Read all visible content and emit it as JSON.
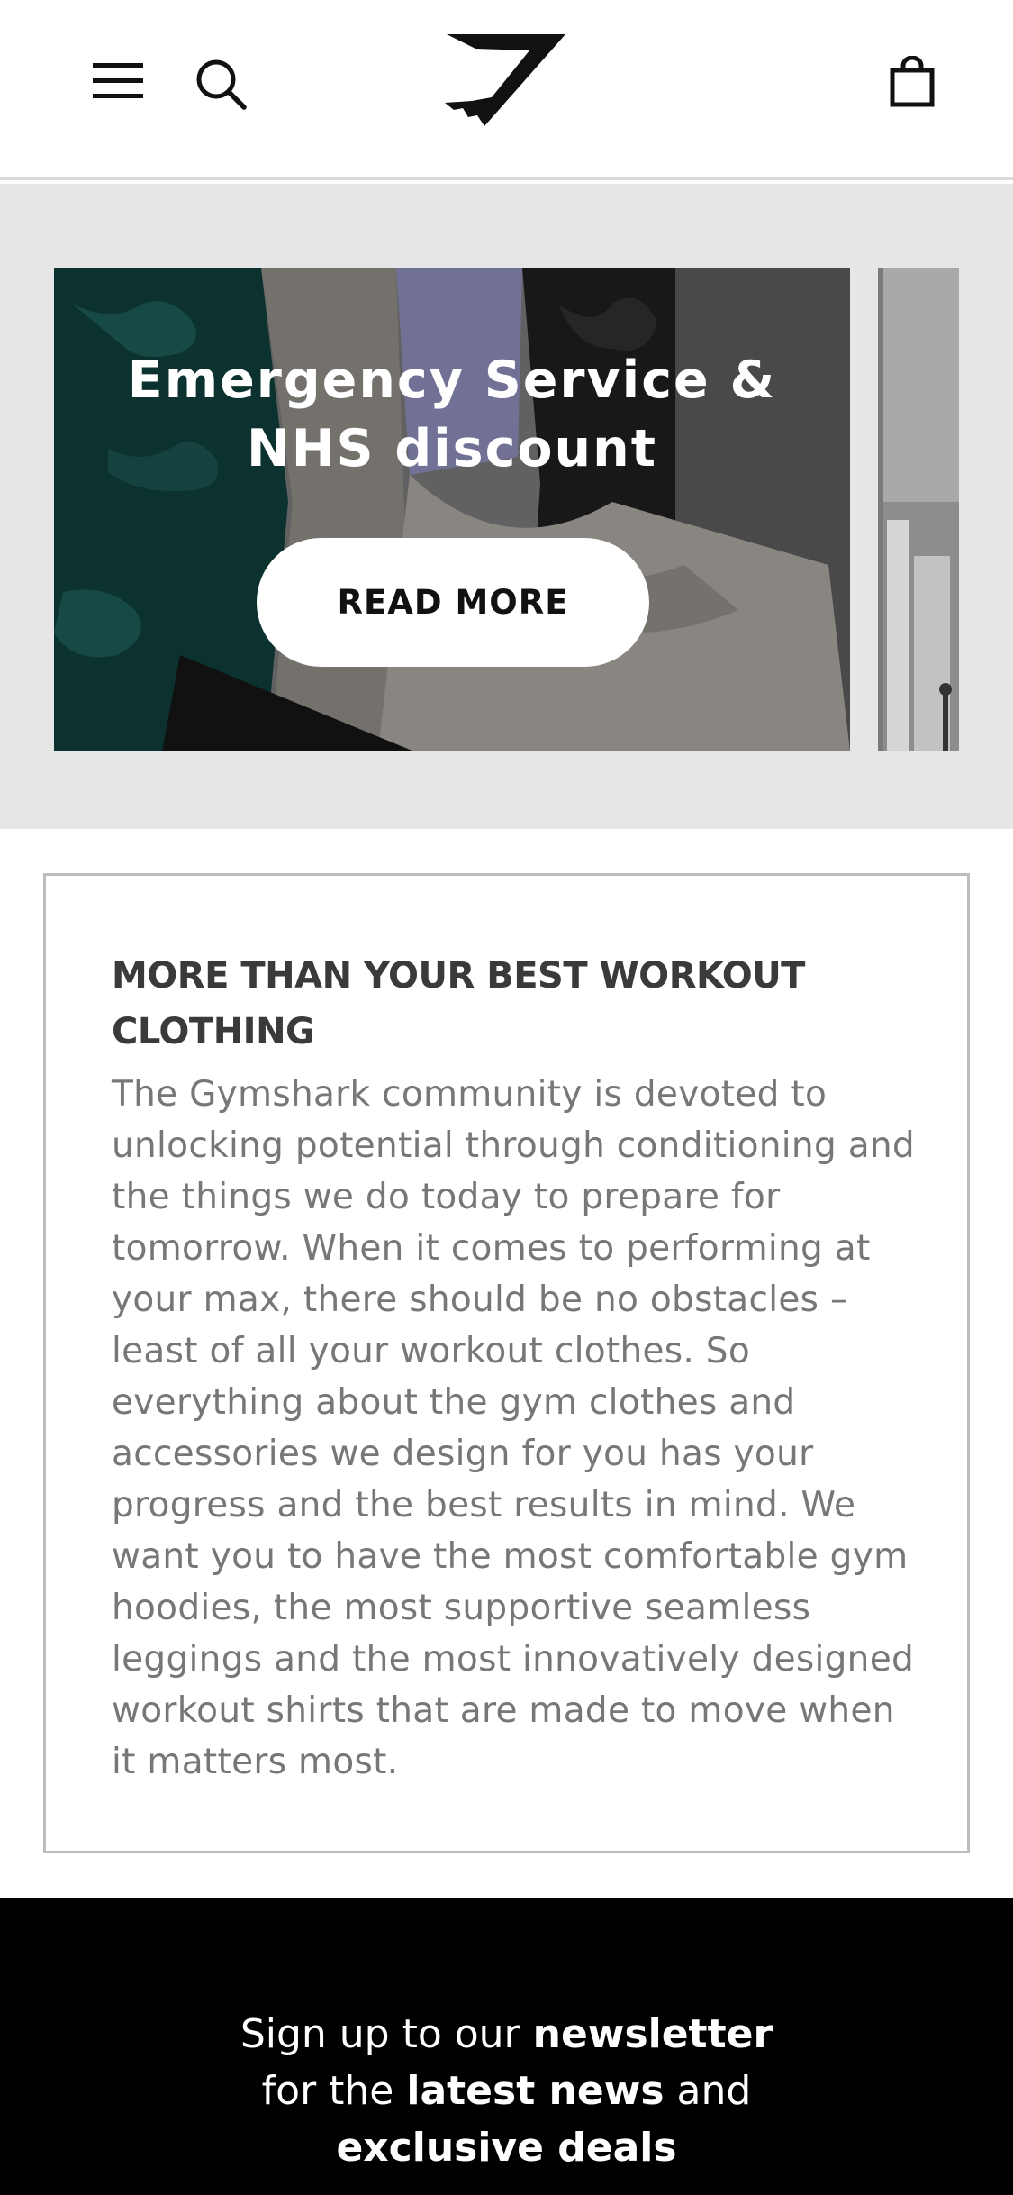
{
  "header": {
    "menu_icon": "hamburger-menu-icon",
    "search_icon": "search-icon",
    "logo": "gymshark-logo",
    "bag_icon": "shopping-bag-icon"
  },
  "carousel": {
    "slides": [
      {
        "title_line1": "Emergency Service &",
        "title_line2": "NHS discount",
        "button_label": "READ MORE"
      }
    ]
  },
  "info": {
    "title": "MORE THAN YOUR BEST WORKOUT CLOTHING",
    "body": "The Gymshark community is devoted to unlocking potential through conditioning and the things we do today to prepare for tomorrow. When it comes to performing at your max, there should be no obstacles – least of all your workout clothes. So everything about the gym clothes and accessories we design for you has your progress and the best results in mind. We want you to have the most comfortable gym hoodies, the most supportive seamless leggings and the most innovatively designed workout shirts that are made to move when it matters most."
  },
  "newsletter": {
    "part1": "Sign up to our ",
    "part2": "newsletter",
    "part3": "for the ",
    "part4": "latest news",
    "part5": " and",
    "part6": "exclusive deals"
  },
  "colors": {
    "header_bg": "#ffffff",
    "carousel_bg": "#e6e6e6",
    "newsletter_bg": "#000000",
    "text_heading": "#3a3a3a",
    "text_body": "#777777"
  }
}
